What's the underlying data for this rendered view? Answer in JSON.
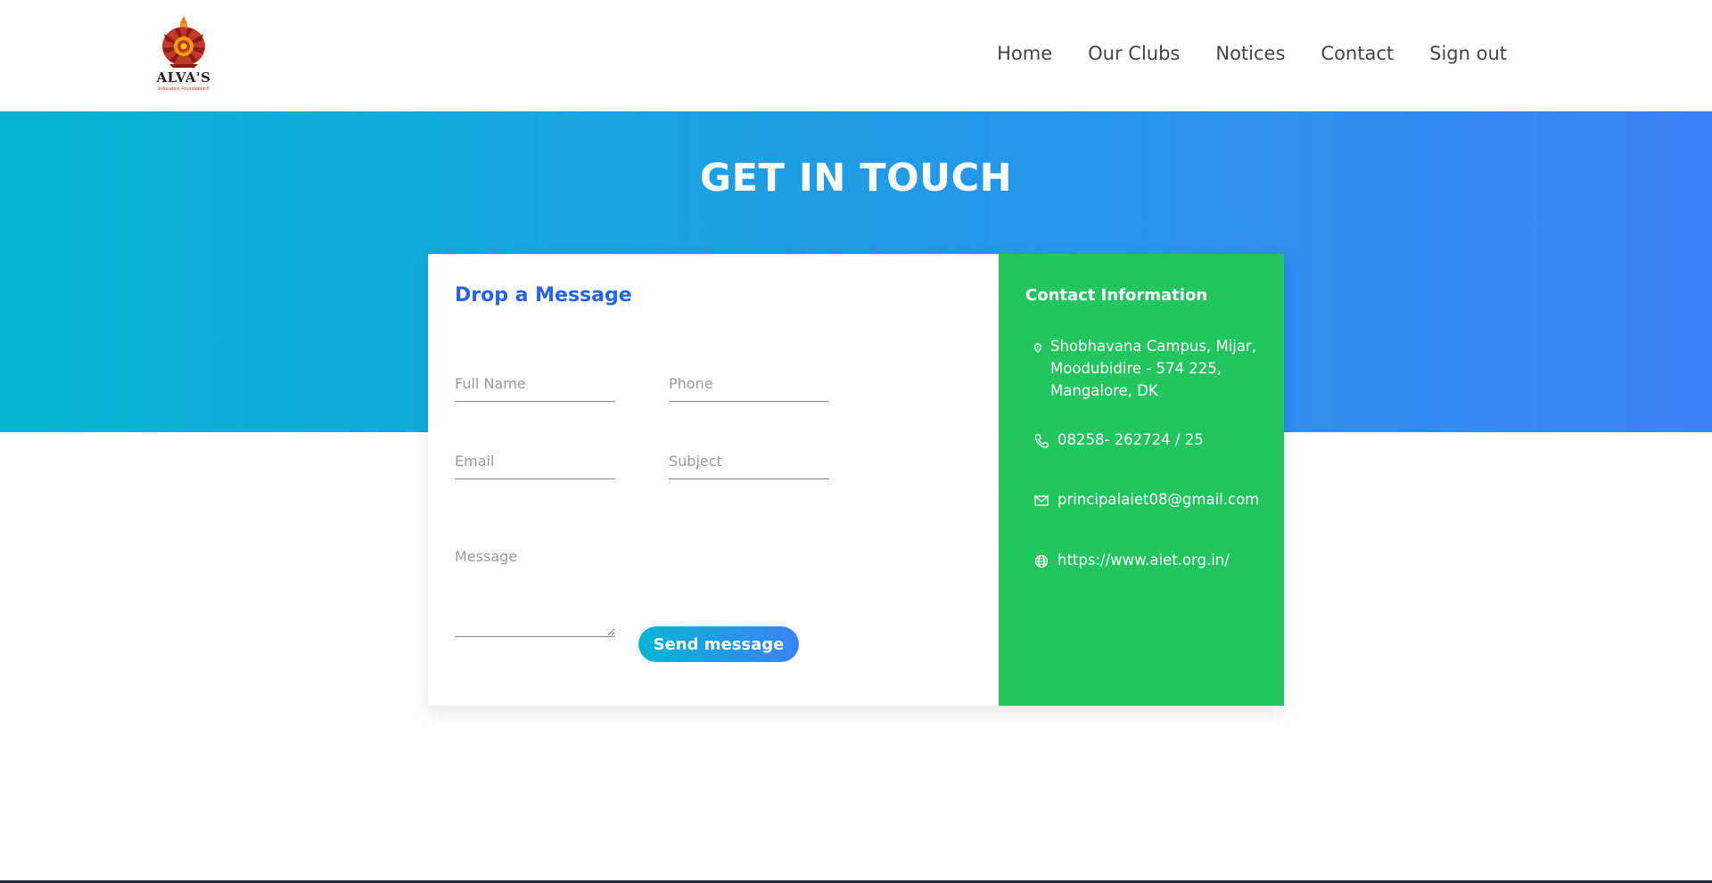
{
  "brand": {
    "logo_name": "ALVA'S",
    "logo_sub": "Education Foundation®"
  },
  "nav": {
    "items": [
      {
        "label": "Home"
      },
      {
        "label": "Our Clubs"
      },
      {
        "label": "Notices"
      },
      {
        "label": "Contact"
      },
      {
        "label": "Sign out"
      }
    ]
  },
  "hero": {
    "title": "GET IN TOUCH"
  },
  "form": {
    "title": "Drop a Message",
    "full_name": {
      "placeholder": "Full Name",
      "value": ""
    },
    "phone": {
      "placeholder": "Phone",
      "value": ""
    },
    "email": {
      "placeholder": "Email",
      "value": ""
    },
    "subject": {
      "placeholder": "Subject",
      "value": ""
    },
    "message": {
      "placeholder": "Message",
      "value": ""
    },
    "send_label": "Send message"
  },
  "contact": {
    "title": "Contact Information",
    "address": "Shobhavana Campus, Mijar, Moodubidire - 574 225, Mangalore, DK",
    "phone": "08258- 262724 / 25",
    "email": "principalaiet08@gmail.com",
    "website": "https://www.aiet.org.in/"
  },
  "colors": {
    "gradient_start": "#06b6d4",
    "gradient_end": "#3b82f6",
    "info_panel": "#22c55e",
    "form_title": "#2563eb"
  }
}
